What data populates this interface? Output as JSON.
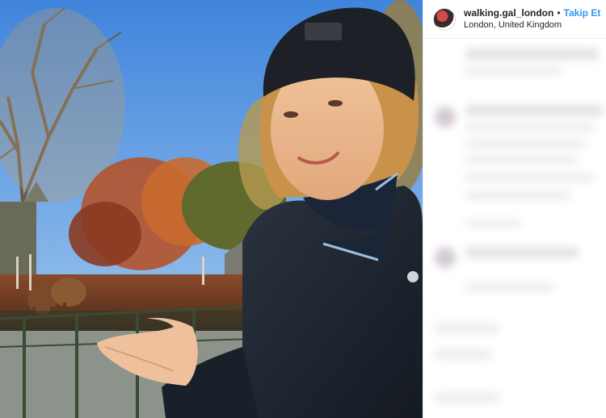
{
  "post": {
    "username": "walking.gal_london",
    "separator": "•",
    "follow_label": "Takip Et",
    "location": "London, United Kingdom"
  },
  "colors": {
    "follow_blue": "#3897f0",
    "text": "#262626",
    "sky": "#4a8de0",
    "coat": "#1d2430",
    "beanie": "#1e2028"
  },
  "icons": [
    "avatar-image"
  ]
}
